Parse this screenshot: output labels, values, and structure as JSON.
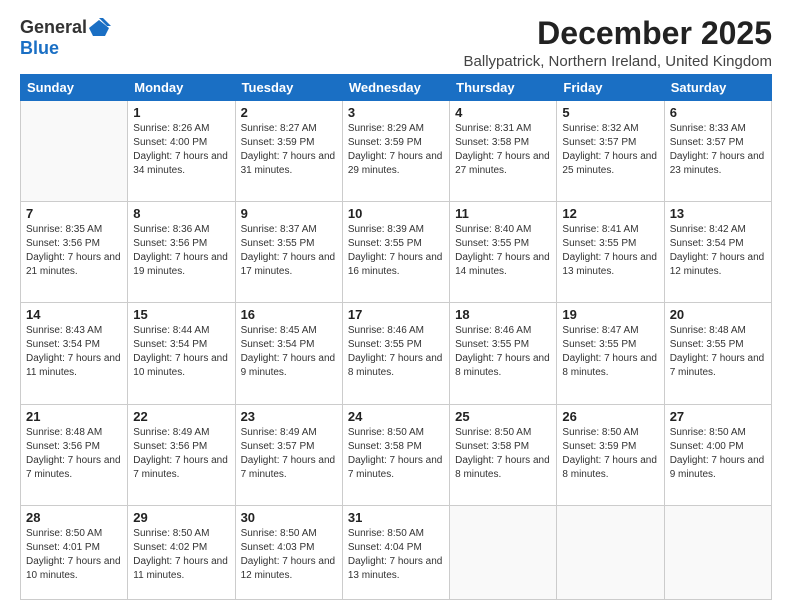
{
  "logo": {
    "general": "General",
    "blue": "Blue"
  },
  "header": {
    "month": "December 2025",
    "location": "Ballypatrick, Northern Ireland, United Kingdom"
  },
  "days": [
    "Sunday",
    "Monday",
    "Tuesday",
    "Wednesday",
    "Thursday",
    "Friday",
    "Saturday"
  ],
  "weeks": [
    [
      {
        "num": "",
        "sunrise": "",
        "sunset": "",
        "daylight": ""
      },
      {
        "num": "1",
        "sunrise": "Sunrise: 8:26 AM",
        "sunset": "Sunset: 4:00 PM",
        "daylight": "Daylight: 7 hours and 34 minutes."
      },
      {
        "num": "2",
        "sunrise": "Sunrise: 8:27 AM",
        "sunset": "Sunset: 3:59 PM",
        "daylight": "Daylight: 7 hours and 31 minutes."
      },
      {
        "num": "3",
        "sunrise": "Sunrise: 8:29 AM",
        "sunset": "Sunset: 3:59 PM",
        "daylight": "Daylight: 7 hours and 29 minutes."
      },
      {
        "num": "4",
        "sunrise": "Sunrise: 8:31 AM",
        "sunset": "Sunset: 3:58 PM",
        "daylight": "Daylight: 7 hours and 27 minutes."
      },
      {
        "num": "5",
        "sunrise": "Sunrise: 8:32 AM",
        "sunset": "Sunset: 3:57 PM",
        "daylight": "Daylight: 7 hours and 25 minutes."
      },
      {
        "num": "6",
        "sunrise": "Sunrise: 8:33 AM",
        "sunset": "Sunset: 3:57 PM",
        "daylight": "Daylight: 7 hours and 23 minutes."
      }
    ],
    [
      {
        "num": "7",
        "sunrise": "Sunrise: 8:35 AM",
        "sunset": "Sunset: 3:56 PM",
        "daylight": "Daylight: 7 hours and 21 minutes."
      },
      {
        "num": "8",
        "sunrise": "Sunrise: 8:36 AM",
        "sunset": "Sunset: 3:56 PM",
        "daylight": "Daylight: 7 hours and 19 minutes."
      },
      {
        "num": "9",
        "sunrise": "Sunrise: 8:37 AM",
        "sunset": "Sunset: 3:55 PM",
        "daylight": "Daylight: 7 hours and 17 minutes."
      },
      {
        "num": "10",
        "sunrise": "Sunrise: 8:39 AM",
        "sunset": "Sunset: 3:55 PM",
        "daylight": "Daylight: 7 hours and 16 minutes."
      },
      {
        "num": "11",
        "sunrise": "Sunrise: 8:40 AM",
        "sunset": "Sunset: 3:55 PM",
        "daylight": "Daylight: 7 hours and 14 minutes."
      },
      {
        "num": "12",
        "sunrise": "Sunrise: 8:41 AM",
        "sunset": "Sunset: 3:55 PM",
        "daylight": "Daylight: 7 hours and 13 minutes."
      },
      {
        "num": "13",
        "sunrise": "Sunrise: 8:42 AM",
        "sunset": "Sunset: 3:54 PM",
        "daylight": "Daylight: 7 hours and 12 minutes."
      }
    ],
    [
      {
        "num": "14",
        "sunrise": "Sunrise: 8:43 AM",
        "sunset": "Sunset: 3:54 PM",
        "daylight": "Daylight: 7 hours and 11 minutes."
      },
      {
        "num": "15",
        "sunrise": "Sunrise: 8:44 AM",
        "sunset": "Sunset: 3:54 PM",
        "daylight": "Daylight: 7 hours and 10 minutes."
      },
      {
        "num": "16",
        "sunrise": "Sunrise: 8:45 AM",
        "sunset": "Sunset: 3:54 PM",
        "daylight": "Daylight: 7 hours and 9 minutes."
      },
      {
        "num": "17",
        "sunrise": "Sunrise: 8:46 AM",
        "sunset": "Sunset: 3:55 PM",
        "daylight": "Daylight: 7 hours and 8 minutes."
      },
      {
        "num": "18",
        "sunrise": "Sunrise: 8:46 AM",
        "sunset": "Sunset: 3:55 PM",
        "daylight": "Daylight: 7 hours and 8 minutes."
      },
      {
        "num": "19",
        "sunrise": "Sunrise: 8:47 AM",
        "sunset": "Sunset: 3:55 PM",
        "daylight": "Daylight: 7 hours and 8 minutes."
      },
      {
        "num": "20",
        "sunrise": "Sunrise: 8:48 AM",
        "sunset": "Sunset: 3:55 PM",
        "daylight": "Daylight: 7 hours and 7 minutes."
      }
    ],
    [
      {
        "num": "21",
        "sunrise": "Sunrise: 8:48 AM",
        "sunset": "Sunset: 3:56 PM",
        "daylight": "Daylight: 7 hours and 7 minutes."
      },
      {
        "num": "22",
        "sunrise": "Sunrise: 8:49 AM",
        "sunset": "Sunset: 3:56 PM",
        "daylight": "Daylight: 7 hours and 7 minutes."
      },
      {
        "num": "23",
        "sunrise": "Sunrise: 8:49 AM",
        "sunset": "Sunset: 3:57 PM",
        "daylight": "Daylight: 7 hours and 7 minutes."
      },
      {
        "num": "24",
        "sunrise": "Sunrise: 8:50 AM",
        "sunset": "Sunset: 3:58 PM",
        "daylight": "Daylight: 7 hours and 7 minutes."
      },
      {
        "num": "25",
        "sunrise": "Sunrise: 8:50 AM",
        "sunset": "Sunset: 3:58 PM",
        "daylight": "Daylight: 7 hours and 8 minutes."
      },
      {
        "num": "26",
        "sunrise": "Sunrise: 8:50 AM",
        "sunset": "Sunset: 3:59 PM",
        "daylight": "Daylight: 7 hours and 8 minutes."
      },
      {
        "num": "27",
        "sunrise": "Sunrise: 8:50 AM",
        "sunset": "Sunset: 4:00 PM",
        "daylight": "Daylight: 7 hours and 9 minutes."
      }
    ],
    [
      {
        "num": "28",
        "sunrise": "Sunrise: 8:50 AM",
        "sunset": "Sunset: 4:01 PM",
        "daylight": "Daylight: 7 hours and 10 minutes."
      },
      {
        "num": "29",
        "sunrise": "Sunrise: 8:50 AM",
        "sunset": "Sunset: 4:02 PM",
        "daylight": "Daylight: 7 hours and 11 minutes."
      },
      {
        "num": "30",
        "sunrise": "Sunrise: 8:50 AM",
        "sunset": "Sunset: 4:03 PM",
        "daylight": "Daylight: 7 hours and 12 minutes."
      },
      {
        "num": "31",
        "sunrise": "Sunrise: 8:50 AM",
        "sunset": "Sunset: 4:04 PM",
        "daylight": "Daylight: 7 hours and 13 minutes."
      },
      {
        "num": "",
        "sunrise": "",
        "sunset": "",
        "daylight": ""
      },
      {
        "num": "",
        "sunrise": "",
        "sunset": "",
        "daylight": ""
      },
      {
        "num": "",
        "sunrise": "",
        "sunset": "",
        "daylight": ""
      }
    ]
  ]
}
